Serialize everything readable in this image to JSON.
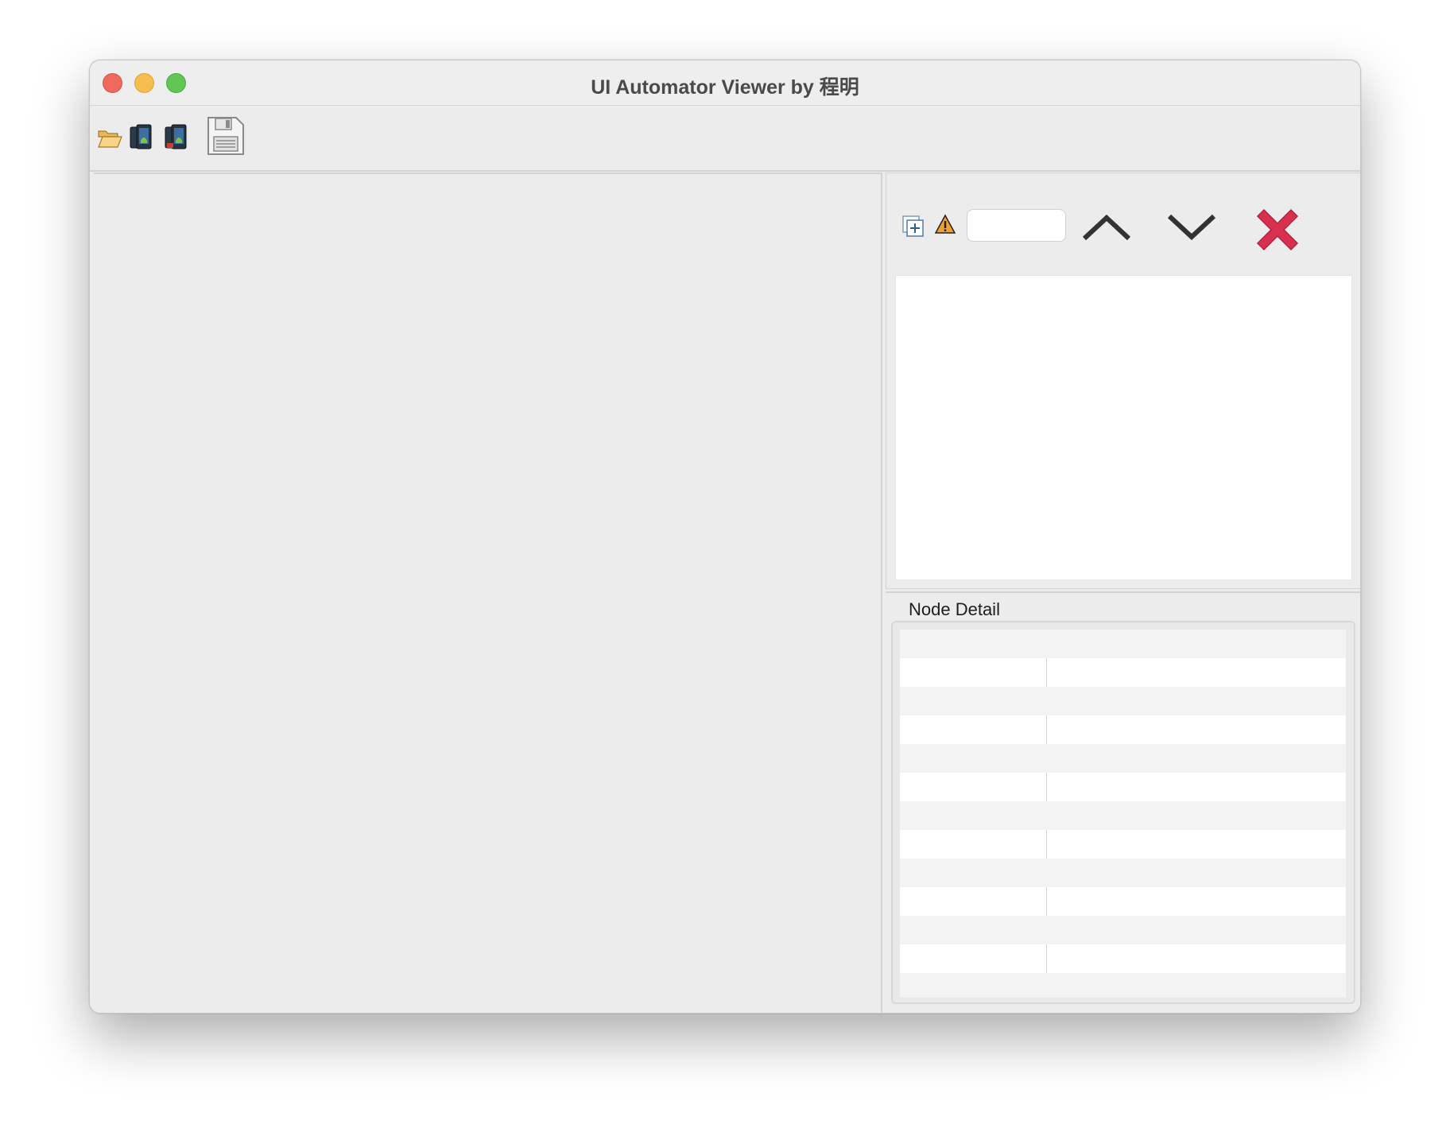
{
  "window": {
    "title": "UI Automator Viewer by 程明"
  },
  "toolbar": {
    "buttons": [
      {
        "name": "open",
        "icon": "open-folder-icon"
      },
      {
        "name": "device-screenshot",
        "icon": "android-device-screenshot-icon"
      },
      {
        "name": "device-screenshot-compressed",
        "icon": "android-device-screenshot-compressed-icon"
      },
      {
        "name": "save",
        "icon": "floppy-disk-save-icon"
      }
    ]
  },
  "search": {
    "value": "",
    "placeholder": "",
    "expand_icon": "expand-all-icon",
    "warning_icon": "warning-icon",
    "prev_icon": "chevron-up-icon",
    "next_icon": "chevron-down-icon",
    "clear_icon": "clear-x-icon"
  },
  "node_detail": {
    "title": "Node Detail",
    "rows": [
      {
        "key": "",
        "value": ""
      },
      {
        "key": "",
        "value": ""
      },
      {
        "key": "",
        "value": ""
      },
      {
        "key": "",
        "value": ""
      },
      {
        "key": "",
        "value": ""
      },
      {
        "key": "",
        "value": ""
      },
      {
        "key": "",
        "value": ""
      },
      {
        "key": "",
        "value": ""
      },
      {
        "key": "",
        "value": ""
      },
      {
        "key": "",
        "value": ""
      },
      {
        "key": "",
        "value": ""
      },
      {
        "key": "",
        "value": ""
      },
      {
        "key": "",
        "value": ""
      }
    ]
  },
  "colors": {
    "close": "#ee6a5f",
    "minimize": "#f5be4f",
    "maximize": "#62c655",
    "clear_x": "#d9304f",
    "warning": "#f0a030"
  }
}
